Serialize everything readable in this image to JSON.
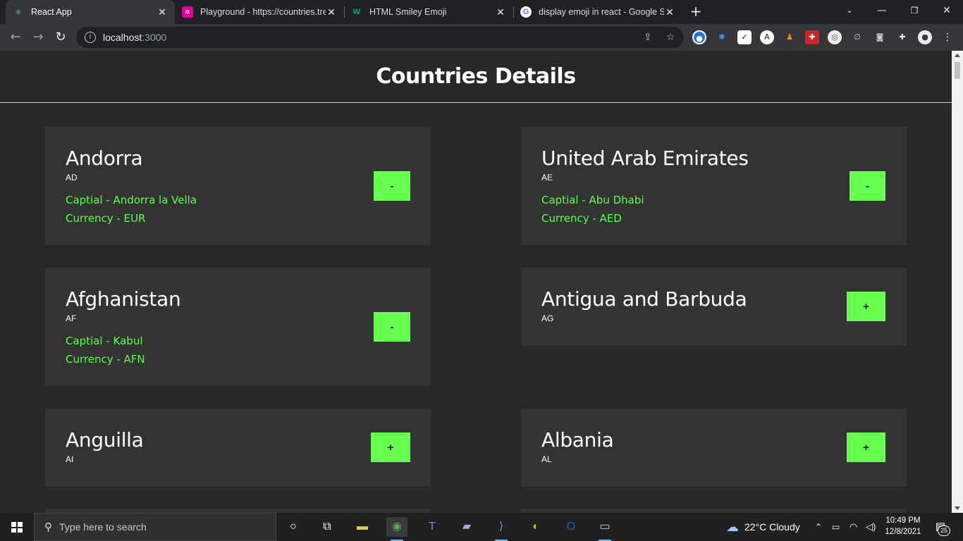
{
  "browser": {
    "tabs": [
      {
        "title": "React App",
        "favicon": "react-icon",
        "active": true
      },
      {
        "title": "Playground - https://countries.tre",
        "favicon": "graphql-icon",
        "active": false
      },
      {
        "title": "HTML Smiley Emoji",
        "favicon": "w3-icon",
        "active": false
      },
      {
        "title": "display emoji in react - Google Se",
        "favicon": "google-icon",
        "active": false
      }
    ],
    "url_host": "localhost",
    "url_port": ":3000"
  },
  "page": {
    "title": "Countries Details",
    "countries": [
      {
        "name": "Andorra",
        "code": "AD",
        "capital": "Captial - Andorra la Vella",
        "currency": "Currency - EUR",
        "toggle": "-",
        "expanded": true
      },
      {
        "name": "United Arab Emirates",
        "code": "AE",
        "capital": "Captial - Abu Dhabi",
        "currency": "Currency - AED",
        "toggle": "-",
        "expanded": true
      },
      {
        "name": "Afghanistan",
        "code": "AF",
        "capital": "Captial - Kabul",
        "currency": "Currency - AFN",
        "toggle": "-",
        "expanded": true
      },
      {
        "name": "Antigua and Barbuda",
        "code": "AG",
        "toggle": "+",
        "expanded": false
      },
      {
        "name": "Anguilla",
        "code": "AI",
        "toggle": "+",
        "expanded": false
      },
      {
        "name": "Albania",
        "code": "AL",
        "toggle": "+",
        "expanded": false
      }
    ]
  },
  "taskbar": {
    "search_placeholder": "Type here to search",
    "weather": "22°C  Cloudy",
    "time": "10:49 PM",
    "date": "12/8/2021",
    "notifications": "25"
  },
  "colors": {
    "accent_green": "#66ff4f",
    "text_green": "#5cff4a",
    "card_bg": "#333333",
    "page_bg": "#282828"
  }
}
